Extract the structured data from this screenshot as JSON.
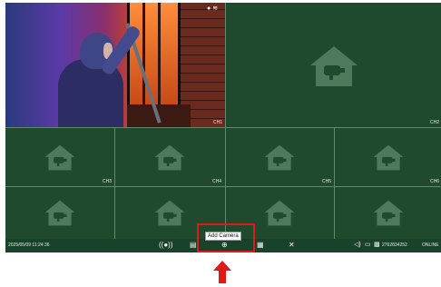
{
  "live": {
    "channel": "CH1"
  },
  "channels": [
    "CH2",
    "CH3",
    "CH4",
    "CH5",
    "CH6"
  ],
  "status_bar": {
    "datetime": "2025/05/09 11:24:36",
    "serial": "2762834252",
    "connection": "ONLINE"
  },
  "tooltip": {
    "add_camera": "Add Camera"
  },
  "icons": [
    "record-icon",
    "calendar-icon",
    "add-camera-icon",
    "grid-layout-icon",
    "settings-tools-icon",
    "volume-icon",
    "chat-icon",
    "qr-code-icon",
    "info-icon",
    "wifi-icon",
    "camera-house-icon",
    "red-arrow-icon"
  ],
  "colors": {
    "screen_bg": "#1f4a2e",
    "bar_bg": "#18422a",
    "highlight": "#e01919"
  }
}
